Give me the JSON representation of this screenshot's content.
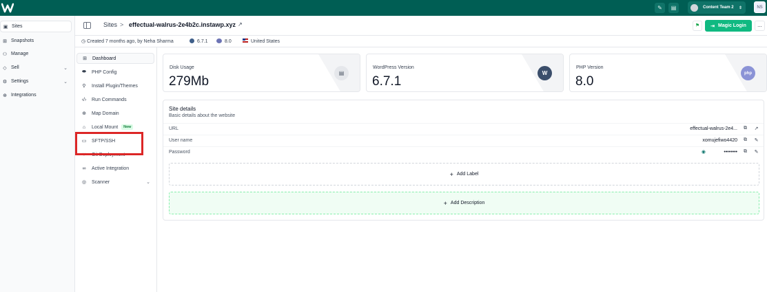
{
  "topbar": {
    "team_name": "Content Team 2",
    "user_initials": "NS",
    "colors": {
      "brand": "#005e54",
      "accent": "#10b981"
    }
  },
  "sidebar": {
    "items": [
      {
        "label": "Sites",
        "icon": "sites-icon",
        "active": true
      },
      {
        "label": "Snapshots",
        "icon": "snapshots-icon"
      },
      {
        "label": "Manage",
        "icon": "manage-icon"
      },
      {
        "label": "Sell",
        "icon": "sell-icon",
        "expandable": true
      },
      {
        "label": "Settings",
        "icon": "settings-icon",
        "expandable": true
      },
      {
        "label": "Integrations",
        "icon": "integrations-icon"
      }
    ]
  },
  "header": {
    "breadcrumb_root": "Sites",
    "breadcrumb_separator": ">",
    "site_name": "effectual-walrus-2e4b2c.instawp.xyz",
    "magic_login_label": "Magic Login",
    "more_label": "..."
  },
  "meta": {
    "created": "Created 7 months ago, by Neha Sharma",
    "wp_version": "6.7.1",
    "php_version": "8.0",
    "region": "United States"
  },
  "subnav": {
    "items": [
      {
        "label": "Dashboard",
        "icon": "dashboard-icon",
        "active": true
      },
      {
        "label": "PHP Config",
        "icon": "php-icon"
      },
      {
        "label": "Install Plugin/Themes",
        "icon": "plugin-icon"
      },
      {
        "label": "Run Commands",
        "icon": "code-icon"
      },
      {
        "label": "Map Domain",
        "icon": "globe-icon"
      },
      {
        "label": "Local Mount",
        "icon": "home-icon",
        "badge": "New"
      },
      {
        "label": "SFTP/SSH",
        "icon": "terminal-icon"
      },
      {
        "label": "Git Deployment",
        "icon": "git-icon"
      },
      {
        "label": "Active Integration",
        "icon": "link-icon"
      },
      {
        "label": "Scanner",
        "icon": "scanner-icon",
        "expandable": true
      }
    ]
  },
  "cards": [
    {
      "label": "Disk Usage",
      "value": "279Mb",
      "icon": "file-icon"
    },
    {
      "label": "WordPress Version",
      "value": "6.7.1",
      "icon": "wordpress-icon"
    },
    {
      "label": "PHP Version",
      "value": "8.0",
      "icon": "php-logo-icon"
    }
  ],
  "details": {
    "title": "Site details",
    "subtitle": "Basic details about the website",
    "url_label": "URL",
    "url_value": "effectual-walrus-2e4...",
    "username_label": "User name",
    "username_value": "xomujefiwo4420",
    "password_label": "Password",
    "password_value": "••••••••",
    "add_label": "Add Label",
    "add_description": "Add Description"
  }
}
